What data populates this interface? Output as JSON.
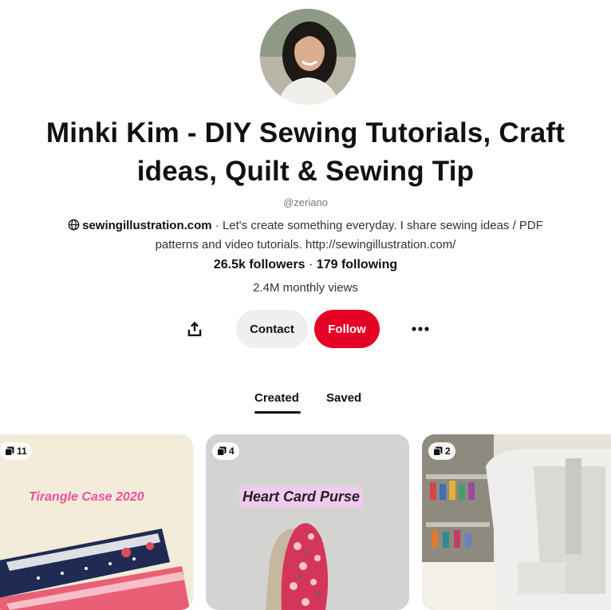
{
  "profile": {
    "name": "Minki Kim - DIY Sewing Tutorials, Craft ideas, Quilt & Sewing Tip",
    "handle": "@zeriano",
    "website": "sewingillustration.com",
    "bio": " · Let's create something everyday. I share sewing ideas / PDF patterns and video tutorials. http://sewingillustration.com/",
    "followers": "26.5k followers",
    "separator": " · ",
    "following": "179 following",
    "monthly_views": "2.4M monthly views"
  },
  "actions": {
    "share_icon": "share-icon",
    "contact_label": "Contact",
    "follow_label": "Follow",
    "more_icon": "more-options-icon"
  },
  "colors": {
    "follow_button": "#e60023",
    "contact_button": "#efefef",
    "card_title_pink": "#ee4fa0"
  },
  "tabs": [
    {
      "label": "Created",
      "active": true
    },
    {
      "label": "Saved",
      "active": false
    }
  ],
  "pins": [
    {
      "count": "11",
      "title": "Tirangle Case 2020"
    },
    {
      "count": "4",
      "title": "Heart Card Purse"
    },
    {
      "count": "2",
      "title": ""
    }
  ]
}
